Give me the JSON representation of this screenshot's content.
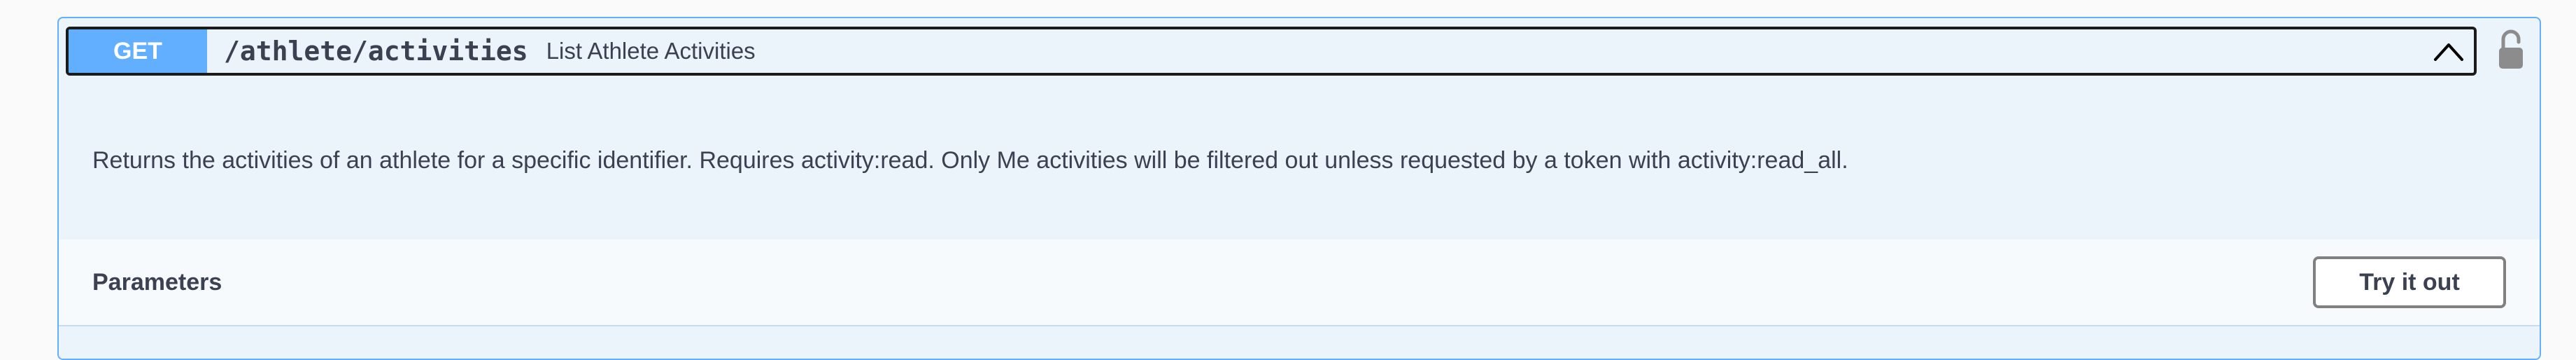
{
  "operation": {
    "method": "GET",
    "path": "/athlete/activities",
    "summary": "List Athlete Activities",
    "description": "Returns the activities of an athlete for a specific identifier. Requires activity:read. Only Me activities will be filtered out unless requested by a token with activity:read_all.",
    "expanded": true,
    "locked": false
  },
  "parameters": {
    "title": "Parameters",
    "try_button_label": "Try it out"
  },
  "colors": {
    "get_method": "#61affe",
    "block_background": "#ebf3fb",
    "text": "#3b4151"
  },
  "icons": {
    "collapse": "chevron-up-icon",
    "auth": "unlocked-padlock-icon"
  }
}
